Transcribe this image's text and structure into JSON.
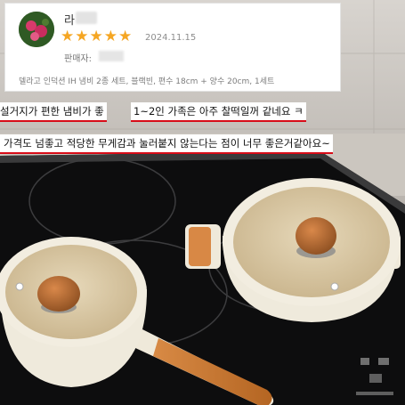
{
  "review": {
    "user_name": "라",
    "rating": 5,
    "stars": [
      "★",
      "★",
      "★",
      "★",
      "★"
    ],
    "date": "2024.11.15",
    "seller_label": "판매자:",
    "product_option": "델라고 인덕션 IH 냄비 2종 세트, 블랙빈, 편수 18cm + 양수 20cm, 1세트",
    "star_color": "#f5a623"
  },
  "captions": {
    "line1": "설거지가 편한 냄비가 좋",
    "line2": "1~2인 가족은 아주 찰떡일꺼 같네요 ㅋ",
    "line3": "가격도 넘좋고 적당한 무게감과 눌러붙지 않는다는 점이 너무 좋은거같아요~",
    "underline_color": "#d80c18"
  },
  "photo": {
    "subject": "cream enamel saucepan and pot with wooden handles on black induction cooktop"
  }
}
